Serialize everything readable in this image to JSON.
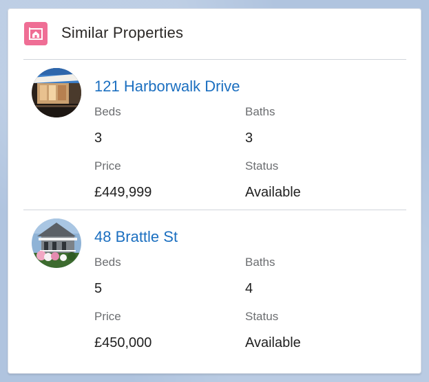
{
  "card": {
    "title": "Similar Properties",
    "icon": "house-icon",
    "accent_color": "#ef6e95"
  },
  "properties": [
    {
      "address": "121 Harborwalk Drive",
      "beds_label": "Beds",
      "beds": "3",
      "baths_label": "Baths",
      "baths": "3",
      "price_label": "Price",
      "price": "£449,999",
      "status_label": "Status",
      "status": "Available"
    },
    {
      "address": "48 Brattle St",
      "beds_label": "Beds",
      "beds": "5",
      "baths_label": "Baths",
      "baths": "4",
      "price_label": "Price",
      "price": "£450,000",
      "status_label": "Status",
      "status": "Available"
    }
  ]
}
